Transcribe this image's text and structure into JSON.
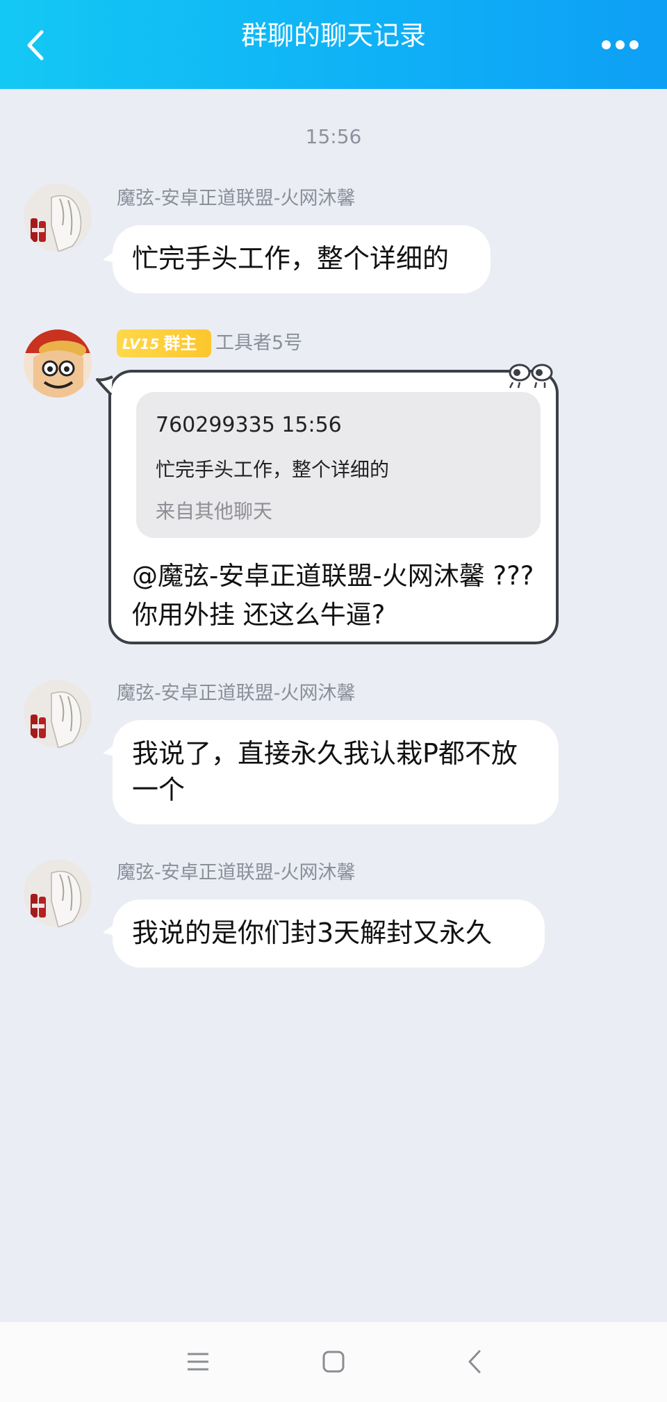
{
  "header": {
    "title": "群聊的聊天记录",
    "back_icon": "chevron-left-icon",
    "more_icon": "more-dots-icon"
  },
  "timestamp": "15:56",
  "messages": [
    {
      "sender": "魔弦-安卓正道联盟-火网沐馨",
      "text": "忙完手头工作，整个详细的"
    },
    {
      "badge_level": "LV15",
      "badge_role": "群主",
      "sender": "工具者5号",
      "quote": {
        "meta": "760299335 15:56",
        "text": "忙完手头工作，整个详细的",
        "source": "来自其他聊天"
      },
      "text": "@魔弦-安卓正道联盟-火网沐馨 ??? 你用外挂 还这么牛逼?"
    },
    {
      "sender": "魔弦-安卓正道联盟-火网沐馨",
      "text": "我说了，直接永久我认栽P都不放一个"
    },
    {
      "sender": "魔弦-安卓正道联盟-火网沐馨",
      "text": "我说的是你们封3天解封又永久"
    }
  ],
  "navbar": {
    "menu_icon": "menu-icon",
    "home_icon": "home-square-icon",
    "back_icon": "back-triangle-icon"
  },
  "colors": {
    "header_start": "#14c8f4",
    "header_end": "#0e9ff5",
    "background": "#ebedf5",
    "badge": "#fcc62d"
  }
}
